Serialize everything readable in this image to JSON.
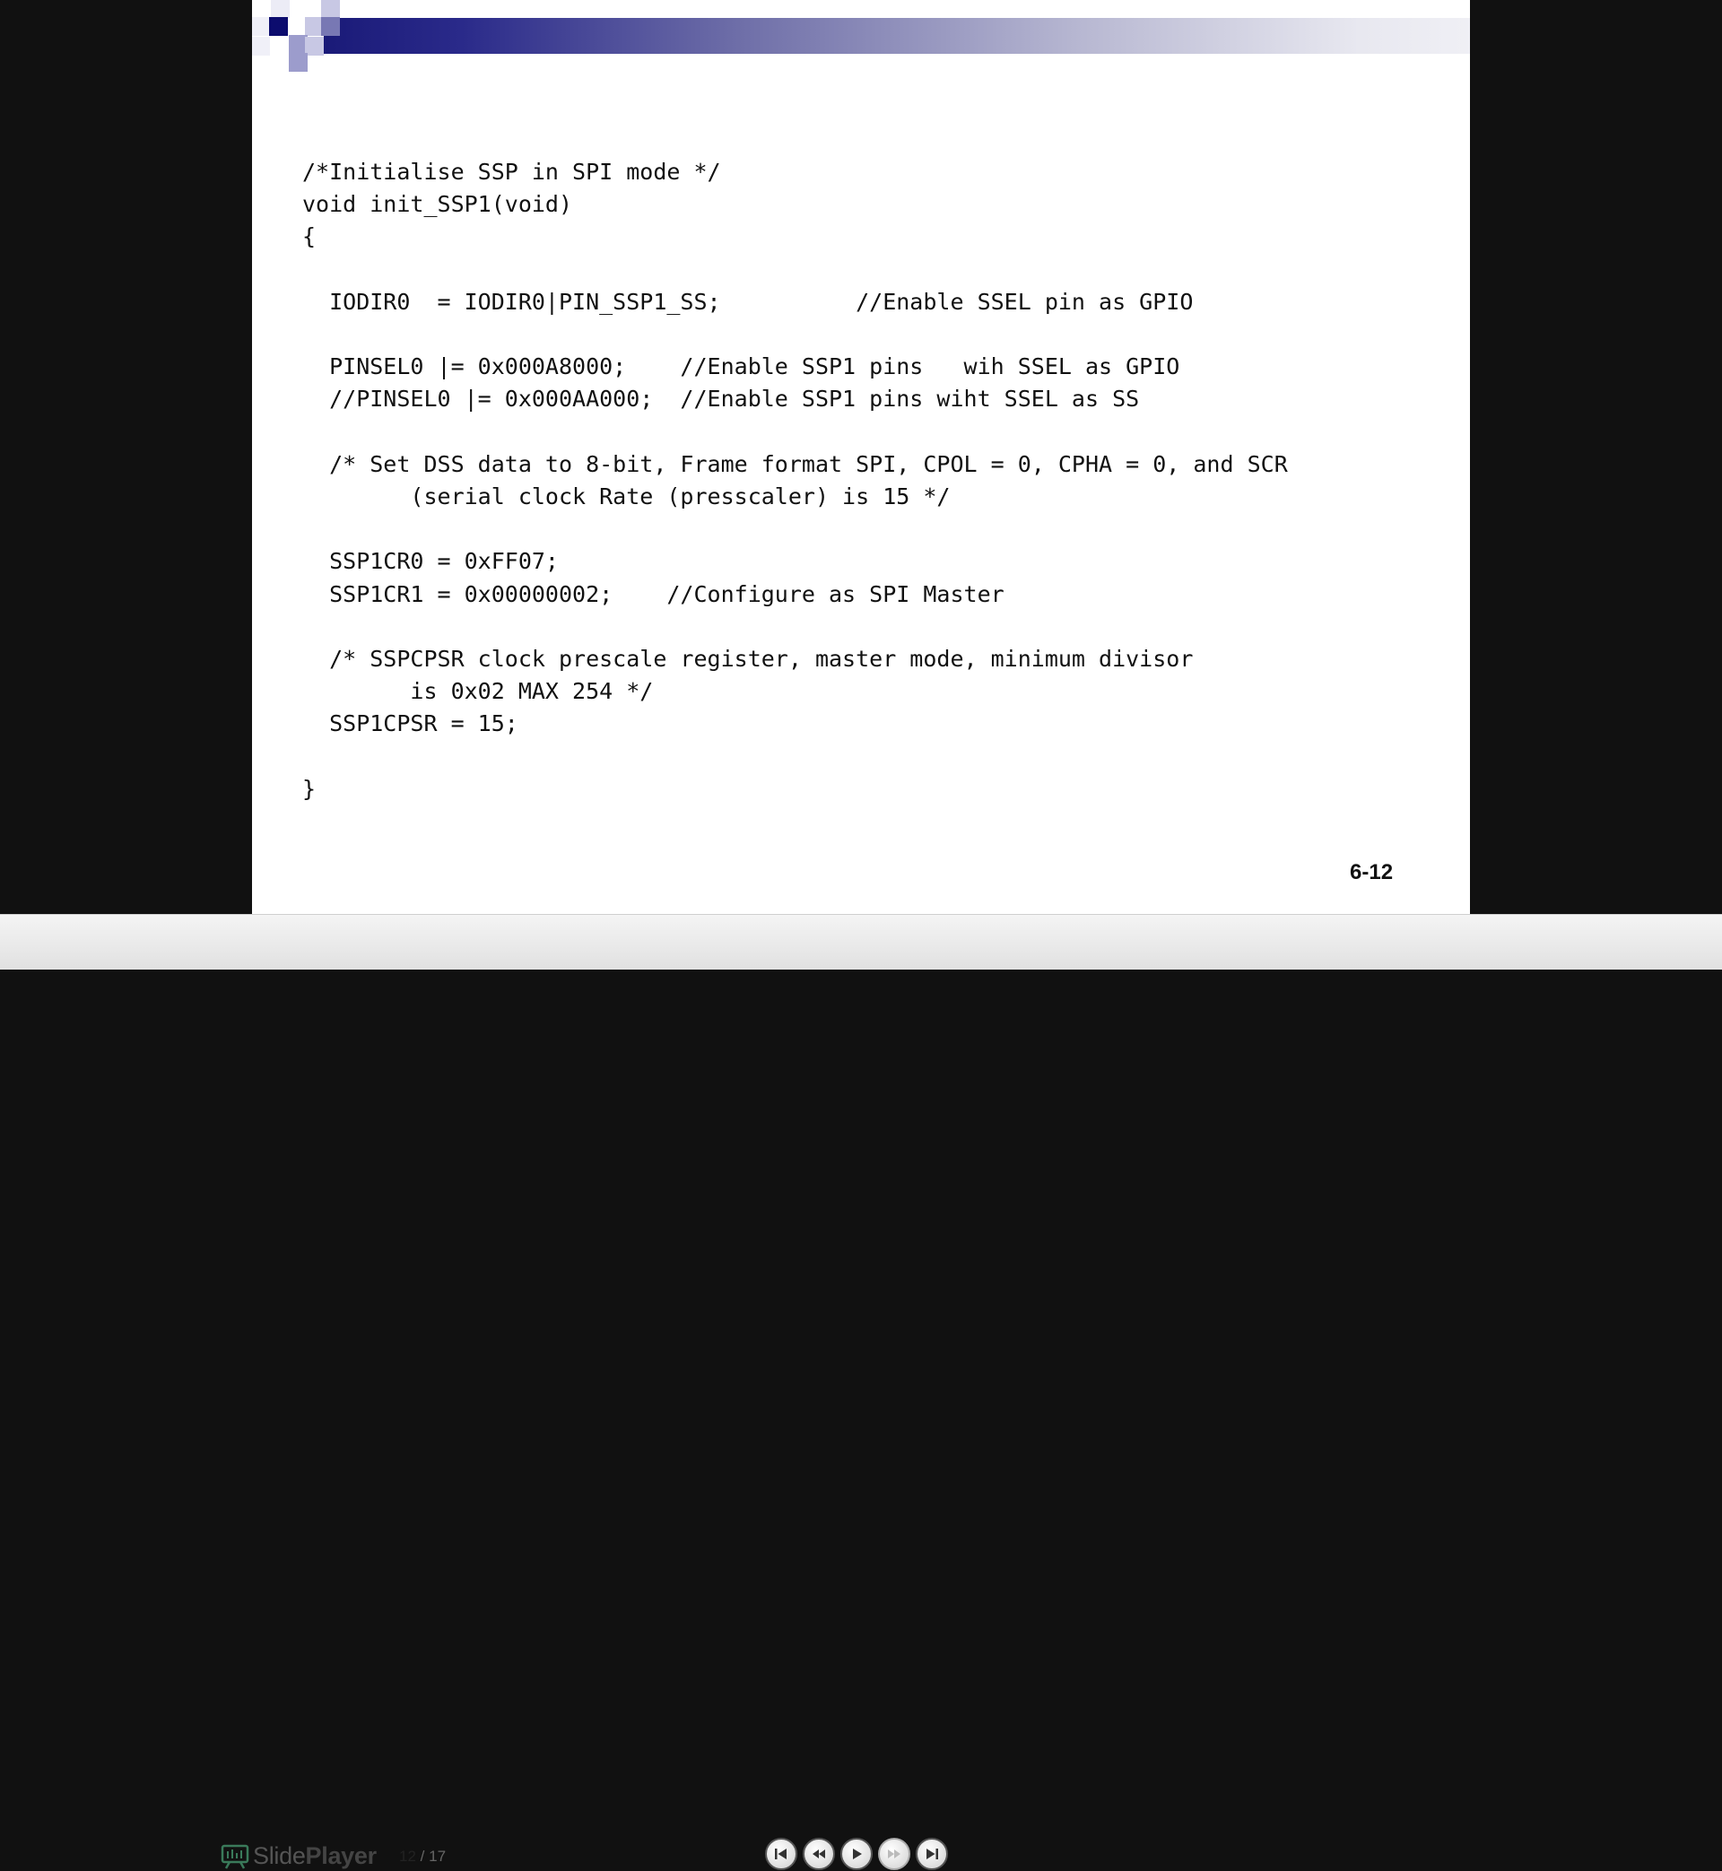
{
  "slide": {
    "code_lines": [
      "/*Initialise SSP in SPI mode */",
      "void init_SSP1(void)",
      "{",
      "",
      "  IODIR0  = IODIR0|PIN_SSP1_SS;          //Enable SSEL pin as GPIO",
      "",
      "  PINSEL0 |= 0x000A8000;    //Enable SSP1 pins   wih SSEL as GPIO",
      "  //PINSEL0 |= 0x000AA000;  //Enable SSP1 pins wiht SSEL as SS",
      "",
      "  /* Set DSS data to 8-bit, Frame format SPI, CPOL = 0, CPHA = 0, and SCR",
      "        (serial clock Rate (presscaler) is 15 */",
      "",
      "  SSP1CR0 = 0xFF07;",
      "  SSP1CR1 = 0x00000002;    //Configure as SPI Master",
      "",
      "  /* SSPCPSR clock prescale register, master mode, minimum divisor",
      "        is 0x02 MAX 254 */",
      "  SSP1CPSR = 15;",
      "",
      "}"
    ],
    "page_number": "6-12"
  },
  "player": {
    "brand_light": "Slide",
    "brand_bold": "Player",
    "current_page": "12",
    "page_separator": "/",
    "total_pages": "17",
    "buttons": [
      {
        "name": "first-slide-button",
        "icon": "skip-to-start-icon",
        "enabled": true
      },
      {
        "name": "previous-slide-button",
        "icon": "rewind-icon",
        "enabled": true
      },
      {
        "name": "play-button",
        "icon": "play-icon",
        "enabled": true
      },
      {
        "name": "next-slide-button",
        "icon": "fast-forward-icon",
        "enabled": false
      },
      {
        "name": "last-slide-button",
        "icon": "skip-to-end-icon",
        "enabled": true
      }
    ]
  },
  "colors": {
    "banner_dark": "#1a1a78",
    "square_dark": "#0c0c6e",
    "square_light": "#c8c8e4",
    "page_background": "#111111"
  }
}
